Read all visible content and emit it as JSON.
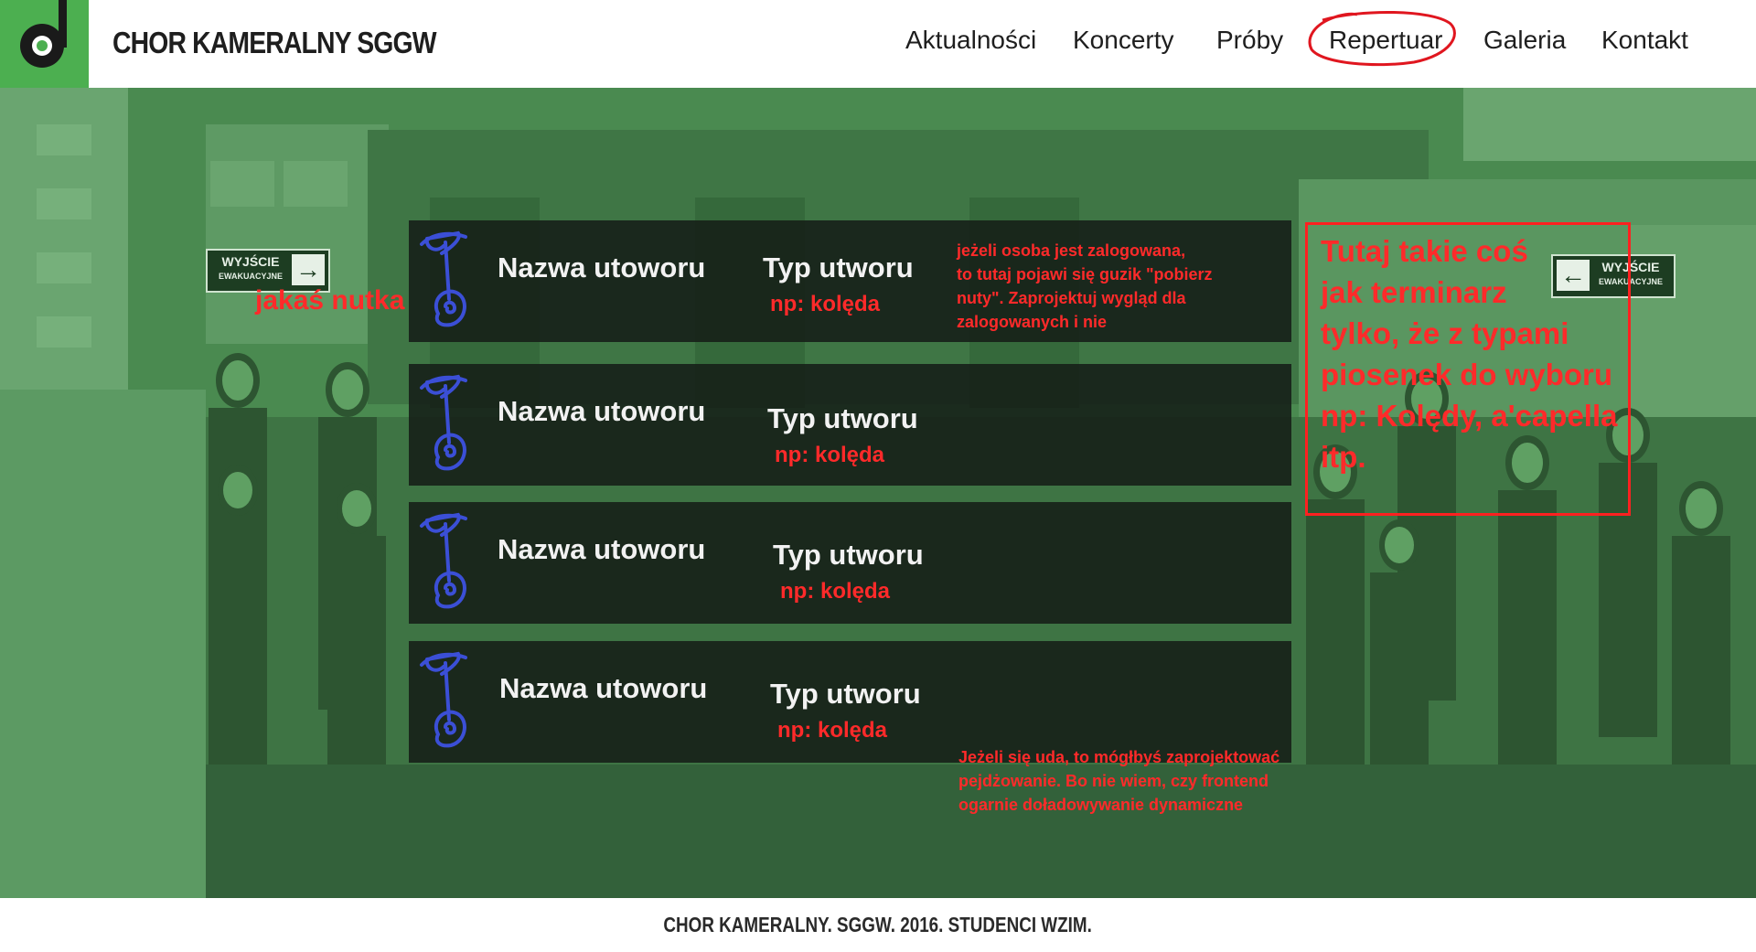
{
  "header": {
    "brand": "CHOR KAMERALNY SGGW",
    "nav": [
      {
        "label": "Aktualności"
      },
      {
        "label": "Koncerty"
      },
      {
        "label": "Próby"
      },
      {
        "label": "Repertuar"
      },
      {
        "label": "Galeria"
      },
      {
        "label": "Kontakt"
      }
    ]
  },
  "signs": {
    "left": {
      "line1": "WYJŚCIE",
      "line2": "EWAKUACYJNE"
    },
    "right": {
      "line1": "WYJŚCIE",
      "line2": "EWAKUACYJNE"
    }
  },
  "songs": [
    {
      "name": "Nazwa utoworu",
      "type": "Typ utworu",
      "example": "np: kolęda"
    },
    {
      "name": "Nazwa utoworu",
      "type": "Typ utworu",
      "example": "np: kolęda"
    },
    {
      "name": "Nazwa utoworu",
      "type": "Typ utworu",
      "example": "np: kolęda"
    },
    {
      "name": "Nazwa utoworu",
      "type": "Typ utworu",
      "example": "np: kolęda"
    }
  ],
  "annotations": {
    "note_label": "jakaś nutka",
    "login_note": "jeżeli osoba jest zalogowana,\nto tutaj pojawi się guzik \"pobierz\nnuty\". Zaprojektuj wygląd dla\nzalogowanych i nie",
    "pagination_note": "Jeżeli się uda, to mógłbyś zaprojektować\npejdżowanie. Bo nie wiem, czy frontend\nogarnie doładowywanie dynamiczne",
    "sidebar_note": "Tutaj takie coś\njak terminarz\ntylko, że z typami\npiosenek do wyboru\nnp: Kolędy, a'capella\nitp."
  },
  "footer": {
    "text": "CHOR KAMERALNY. SGGW. 2016. STUDENCI WZIM."
  },
  "colors": {
    "brand_green": "#4caf50",
    "annotation_red": "#ff2a2a",
    "annotation_blue": "#3b4fd6"
  }
}
